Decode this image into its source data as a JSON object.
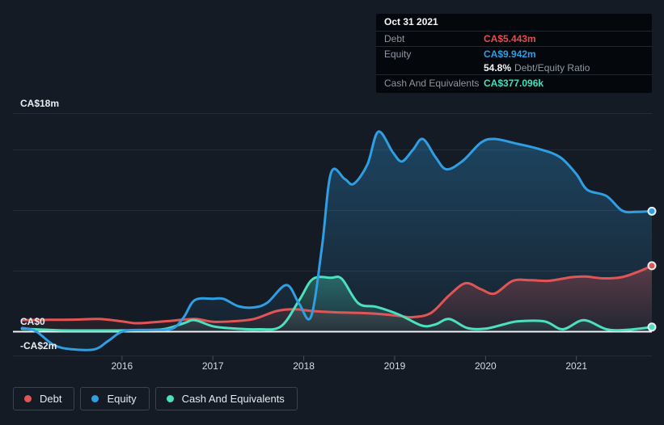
{
  "tooltip": {
    "date": "Oct 31 2021",
    "debt_label": "Debt",
    "debt_value": "CA$5.443m",
    "equity_label": "Equity",
    "equity_value": "CA$9.942m",
    "ratio_value": "54.8%",
    "ratio_label": "Debt/Equity Ratio",
    "cash_label": "Cash And Equivalents",
    "cash_value": "CA$377.096k"
  },
  "legend": {
    "items": [
      {
        "label": "Debt",
        "color": "#e25555"
      },
      {
        "label": "Equity",
        "color": "#2f9ee3"
      },
      {
        "label": "Cash And Equivalents",
        "color": "#4ce0bf"
      }
    ]
  },
  "chart_data": {
    "type": "area",
    "title": "",
    "unit": "CA$ millions",
    "grid": true,
    "legend_position": "bottom-left",
    "x_range": [
      2014.8,
      2021.83
    ],
    "x_axis": {
      "tick_labels": [
        "2016",
        "2017",
        "2018",
        "2019",
        "2020",
        "2021"
      ],
      "tick_years": [
        2016,
        2017,
        2018,
        2019,
        2020,
        2021
      ]
    },
    "y_axis": {
      "labels": [
        {
          "text": "CA$18m",
          "value": 18
        },
        {
          "text": "CA$0",
          "value": 0
        },
        {
          "text": "-CA$2m",
          "value": -2
        }
      ],
      "gridline_values": [
        18,
        15,
        10,
        5,
        0,
        -2
      ],
      "ylim": [
        -2,
        18
      ]
    },
    "series": [
      {
        "name": "Debt",
        "color": "#e25555",
        "end_value_label": "CA$5.443m",
        "points": [
          [
            2014.9,
            0.95
          ],
          [
            2015.2,
            0.98
          ],
          [
            2015.5,
            1.0
          ],
          [
            2015.75,
            1.05
          ],
          [
            2016.0,
            0.85
          ],
          [
            2016.15,
            0.7
          ],
          [
            2016.35,
            0.78
          ],
          [
            2016.55,
            0.9
          ],
          [
            2016.8,
            1.05
          ],
          [
            2017.0,
            0.82
          ],
          [
            2017.2,
            0.85
          ],
          [
            2017.45,
            1.05
          ],
          [
            2017.7,
            1.7
          ],
          [
            2017.9,
            1.85
          ],
          [
            2018.1,
            1.7
          ],
          [
            2018.35,
            1.6
          ],
          [
            2018.6,
            1.55
          ],
          [
            2018.85,
            1.45
          ],
          [
            2019.05,
            1.3
          ],
          [
            2019.2,
            1.2
          ],
          [
            2019.4,
            1.55
          ],
          [
            2019.6,
            3.0
          ],
          [
            2019.78,
            4.0
          ],
          [
            2019.95,
            3.5
          ],
          [
            2020.1,
            3.15
          ],
          [
            2020.3,
            4.2
          ],
          [
            2020.5,
            4.25
          ],
          [
            2020.7,
            4.2
          ],
          [
            2020.95,
            4.5
          ],
          [
            2021.1,
            4.55
          ],
          [
            2021.3,
            4.4
          ],
          [
            2021.5,
            4.5
          ],
          [
            2021.68,
            4.95
          ],
          [
            2021.83,
            5.443
          ]
        ]
      },
      {
        "name": "Equity",
        "color": "#2f9ee3",
        "end_value_label": "CA$9.942m",
        "points": [
          [
            2014.9,
            0.3
          ],
          [
            2015.05,
            0.05
          ],
          [
            2015.25,
            -1.1
          ],
          [
            2015.45,
            -1.45
          ],
          [
            2015.7,
            -1.45
          ],
          [
            2015.85,
            -0.75
          ],
          [
            2016.02,
            0.05
          ],
          [
            2016.3,
            0.15
          ],
          [
            2016.55,
            0.25
          ],
          [
            2016.68,
            1.2
          ],
          [
            2016.8,
            2.6
          ],
          [
            2017.0,
            2.72
          ],
          [
            2017.12,
            2.7
          ],
          [
            2017.28,
            2.1
          ],
          [
            2017.45,
            2.0
          ],
          [
            2017.6,
            2.4
          ],
          [
            2017.81,
            3.85
          ],
          [
            2017.95,
            2.3
          ],
          [
            2018.08,
            1.25
          ],
          [
            2018.2,
            7.0
          ],
          [
            2018.3,
            13.1
          ],
          [
            2018.45,
            12.6
          ],
          [
            2018.55,
            12.2
          ],
          [
            2018.7,
            13.8
          ],
          [
            2018.82,
            16.5
          ],
          [
            2018.98,
            14.8
          ],
          [
            2019.08,
            14.05
          ],
          [
            2019.2,
            15.0
          ],
          [
            2019.31,
            15.9
          ],
          [
            2019.45,
            14.4
          ],
          [
            2019.57,
            13.4
          ],
          [
            2019.75,
            14.1
          ],
          [
            2019.95,
            15.6
          ],
          [
            2020.1,
            15.9
          ],
          [
            2020.35,
            15.5
          ],
          [
            2020.6,
            15.05
          ],
          [
            2020.82,
            14.4
          ],
          [
            2021.0,
            13.0
          ],
          [
            2021.12,
            11.7
          ],
          [
            2021.33,
            11.2
          ],
          [
            2021.5,
            10.0
          ],
          [
            2021.65,
            9.88
          ],
          [
            2021.83,
            9.942
          ]
        ]
      },
      {
        "name": "Cash And Equivalents",
        "color": "#4ce0bf",
        "end_value_label": "CA$377.096k",
        "points": [
          [
            2014.9,
            0.25
          ],
          [
            2015.3,
            0.12
          ],
          [
            2015.7,
            0.1
          ],
          [
            2016.1,
            0.12
          ],
          [
            2016.45,
            0.2
          ],
          [
            2016.68,
            0.7
          ],
          [
            2016.8,
            0.95
          ],
          [
            2017.0,
            0.45
          ],
          [
            2017.2,
            0.28
          ],
          [
            2017.5,
            0.2
          ],
          [
            2017.75,
            0.45
          ],
          [
            2017.95,
            2.6
          ],
          [
            2018.1,
            4.35
          ],
          [
            2018.3,
            4.45
          ],
          [
            2018.42,
            4.35
          ],
          [
            2018.6,
            2.35
          ],
          [
            2018.8,
            2.05
          ],
          [
            2019.05,
            1.4
          ],
          [
            2019.3,
            0.5
          ],
          [
            2019.45,
            0.6
          ],
          [
            2019.6,
            1.05
          ],
          [
            2019.8,
            0.3
          ],
          [
            2020.0,
            0.25
          ],
          [
            2020.2,
            0.6
          ],
          [
            2020.35,
            0.85
          ],
          [
            2020.65,
            0.85
          ],
          [
            2020.85,
            0.2
          ],
          [
            2021.08,
            0.95
          ],
          [
            2021.33,
            0.2
          ],
          [
            2021.55,
            0.15
          ],
          [
            2021.83,
            0.377
          ]
        ]
      }
    ]
  }
}
